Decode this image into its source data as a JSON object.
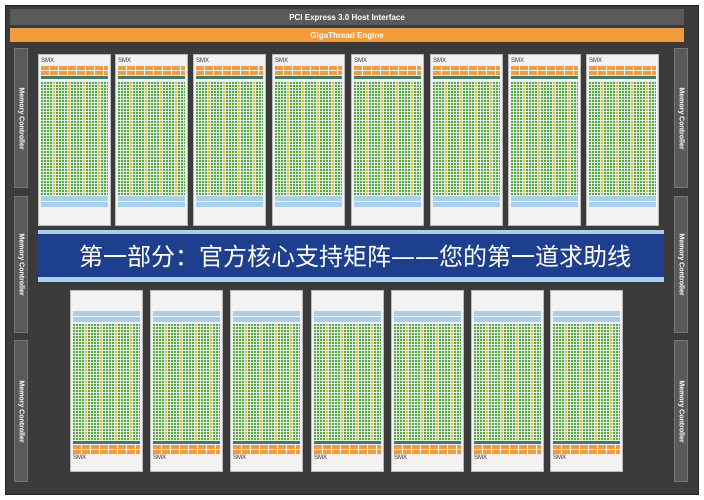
{
  "host_interface": "PCI Express 3.0 Host Interface",
  "engine": "GigaThread Engine",
  "memory_controller_label": "Memory Controller",
  "smx_label": "SMX",
  "banner": "第一部分：官方核心支持矩阵——您的第一道求助线",
  "colors": {
    "frame": "#3b3b3b",
    "engine": "#f29b3a",
    "core_green": "#4caf3a",
    "core_yellow": "#d6c233",
    "cache_blue": "#a8d0ea",
    "banner_bg": "#1e3f8e"
  }
}
